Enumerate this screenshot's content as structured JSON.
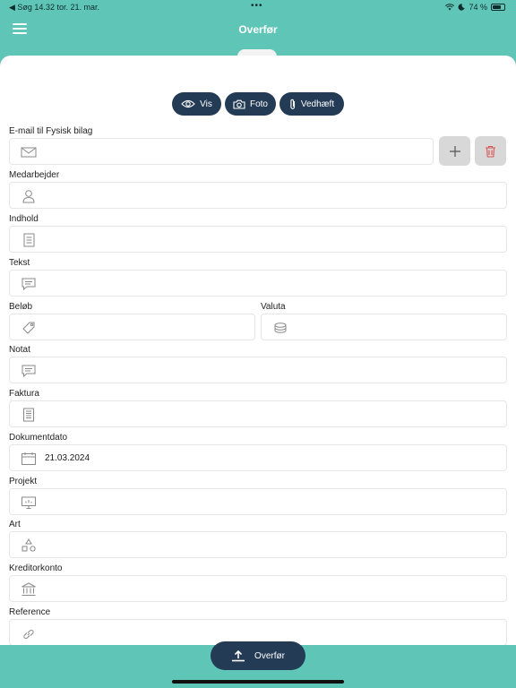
{
  "status_bar": {
    "left": "◀ Søg   14.32   tor. 21. mar.",
    "dots": "•••",
    "battery": "74 %",
    "battery_level": 0.74
  },
  "header": {
    "title": "Overfør"
  },
  "actions": {
    "view": "Vis",
    "photo": "Foto",
    "attach": "Vedhæft"
  },
  "form": {
    "email_label": "E-mail til Fysisk bilag",
    "employee_label": "Medarbejder",
    "content_label": "Indhold",
    "text_label": "Tekst",
    "amount_label": "Beløb",
    "currency_label": "Valuta",
    "note_label": "Notat",
    "invoice_label": "Faktura",
    "docdate_label": "Dokumentdato",
    "docdate_value": "21.03.2024",
    "project_label": "Projekt",
    "type_label": "Art",
    "creditor_label": "Kreditorkonto",
    "reference_label": "Reference"
  },
  "footer": {
    "transfer": "Overfør"
  },
  "colors": {
    "teal": "#5fc6b7",
    "navy": "#243b55",
    "delete": "#d9534f"
  }
}
